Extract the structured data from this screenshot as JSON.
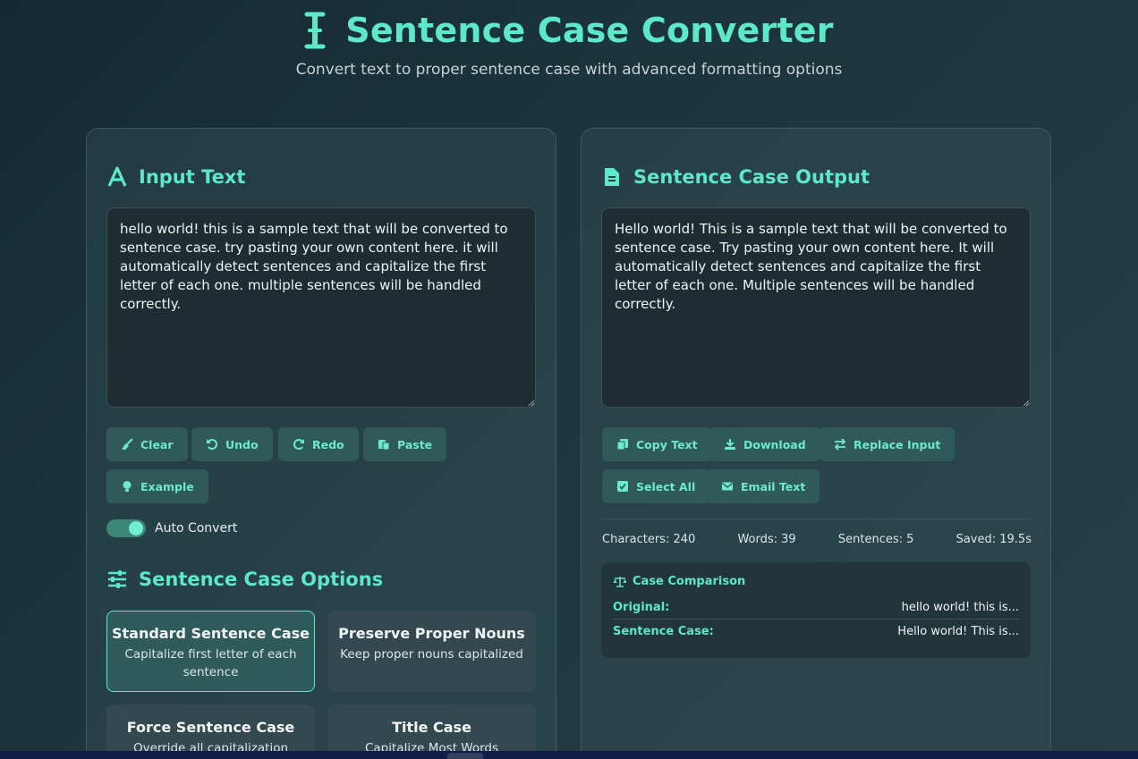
{
  "header": {
    "title": "Sentence Case Converter",
    "subtitle": "Convert text to proper sentence case with advanced formatting options"
  },
  "input_panel": {
    "title": "Input Text",
    "text": "hello world! this is a sample text that will be converted to sentence case. try pasting your own content here. it will automatically detect sentences and capitalize the first letter of each one. multiple sentences will be handled correctly.",
    "buttons": {
      "clear": "Clear",
      "undo": "Undo",
      "redo": "Redo",
      "paste": "Paste",
      "example": "Example"
    },
    "auto_convert": {
      "label": "Auto Convert",
      "enabled": true
    }
  },
  "options": {
    "title": "Sentence Case Options",
    "items": [
      {
        "name": "Standard Sentence Case",
        "desc": "Capitalize first letter of each sentence",
        "active": true
      },
      {
        "name": "Preserve Proper Nouns",
        "desc": "Keep proper nouns capitalized",
        "active": false
      },
      {
        "name": "Force Sentence Case",
        "desc": "Override all capitalization",
        "active": false
      },
      {
        "name": "Title Case",
        "desc": "Capitalize Most Words",
        "active": false
      }
    ]
  },
  "output_panel": {
    "title": "Sentence Case Output",
    "text": "Hello world! This is a sample text that will be converted to sentence case. Try pasting your own content here. It will automatically detect sentences and capitalize the first letter of each one. Multiple sentences will be handled correctly.",
    "buttons": {
      "copy": "Copy Text",
      "download": "Download",
      "replace": "Replace Input",
      "select_all": "Select All",
      "email": "Email Text"
    },
    "stats": {
      "characters": "Characters: 240",
      "words": "Words: 39",
      "sentences": "Sentences: 5",
      "saved": "Saved: 19.5s"
    },
    "comparison": {
      "title": "Case Comparison",
      "original_label": "Original:",
      "original_value": "hello world! this is...",
      "sentence_label": "Sentence Case:",
      "sentence_value": "Hello world! This is..."
    }
  },
  "colors": {
    "accent": "#5de8c8",
    "button_bg": "#2f5a58",
    "background": "#1d363d"
  }
}
